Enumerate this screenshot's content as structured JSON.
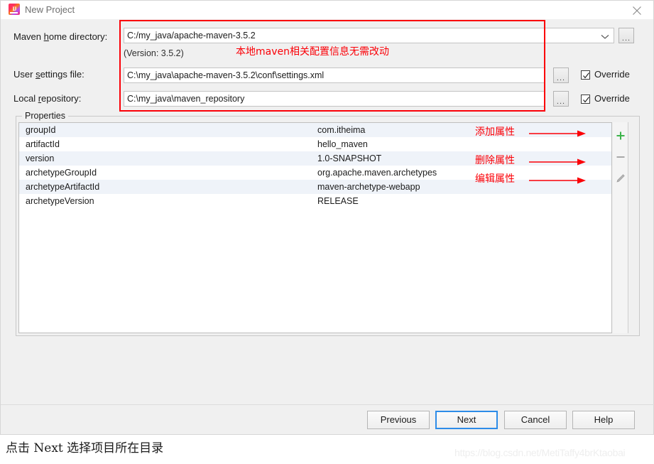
{
  "window": {
    "title": "New Project",
    "icon": "intellij-idea-icon",
    "close_icon": "close-icon"
  },
  "form": {
    "maven_home": {
      "label_pre": "Maven ",
      "label_mnemonic": "h",
      "label_post": "ome directory:",
      "value": "C:/my_java/apache-maven-3.5.2",
      "dropdown_icon": "chevron-down-icon",
      "browse_label": "..."
    },
    "version_note": "(Version: 3.5.2)",
    "user_settings": {
      "label_pre": "User ",
      "label_mnemonic": "s",
      "label_post": "ettings file:",
      "value": "C:\\my_java\\apache-maven-3.5.2\\conf\\settings.xml",
      "browse_label": "...",
      "override_label": "Override",
      "override_checked": true
    },
    "local_repository": {
      "label_pre": "Local ",
      "label_mnemonic": "r",
      "label_post": "epository:",
      "value": "C:\\my_java\\maven_repository",
      "browse_label": "...",
      "override_label": "Override",
      "override_checked": true
    }
  },
  "properties": {
    "legend": "Properties",
    "rows": [
      {
        "key": "groupId",
        "value": "com.itheima"
      },
      {
        "key": "artifactId",
        "value": "hello_maven"
      },
      {
        "key": "version",
        "value": "1.0-SNAPSHOT"
      },
      {
        "key": "archetypeGroupId",
        "value": "org.apache.maven.archetypes"
      },
      {
        "key": "archetypeArtifactId",
        "value": "maven-archetype-webapp"
      },
      {
        "key": "archetypeVersion",
        "value": "RELEASE"
      }
    ],
    "side_buttons": [
      {
        "name": "add-property-button",
        "icon": "plus-icon",
        "label": "+"
      },
      {
        "name": "remove-property-button",
        "icon": "minus-icon",
        "label": "−"
      },
      {
        "name": "edit-property-button",
        "icon": "pencil-icon",
        "label": "✎"
      }
    ]
  },
  "annotations": {
    "top": "本地maven相关配置信息无需改动",
    "add": "添加属性",
    "remove": "删除属性",
    "edit": "编辑属性",
    "color": "#fb0007"
  },
  "buttons": {
    "previous": "Previous",
    "next": "Next",
    "cancel": "Cancel",
    "help": "Help",
    "default_accent": "#2d8ce8"
  },
  "caption": "点击 Next 选择项目所在目录",
  "watermark": "https://blog.csdn.net/MetiTaffy4brKtaobai"
}
